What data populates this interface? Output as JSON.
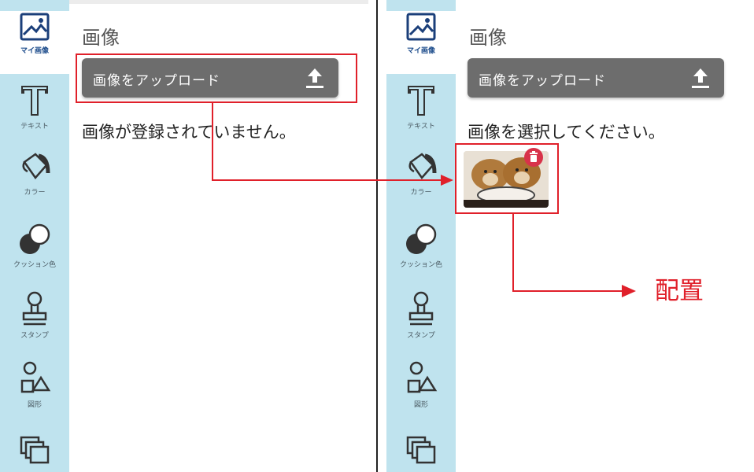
{
  "sidebar": {
    "items": [
      {
        "label": "マイ画像",
        "icon": "image-icon",
        "active": true
      },
      {
        "label": "テキスト",
        "icon": "text-icon"
      },
      {
        "label": "カラー",
        "icon": "paint-bucket-icon"
      },
      {
        "label": "クッション色",
        "icon": "cushion-color-icon"
      },
      {
        "label": "スタンプ",
        "icon": "stamp-icon"
      },
      {
        "label": "図形",
        "icon": "shapes-icon"
      },
      {
        "label": "",
        "icon": "layers-icon"
      }
    ]
  },
  "left_panel": {
    "title": "画像",
    "upload_label": "画像をアップロード",
    "status": "画像が登録されていません。"
  },
  "right_panel": {
    "title": "画像",
    "upload_label": "画像をアップロード",
    "status": "画像を選択してください。"
  },
  "annotation": {
    "label": "配置"
  },
  "colors": {
    "sidebar": "#bfe3ee",
    "button": "#6d6d6d",
    "highlight": "#e0202a",
    "delete_badge": "#d8324a"
  }
}
